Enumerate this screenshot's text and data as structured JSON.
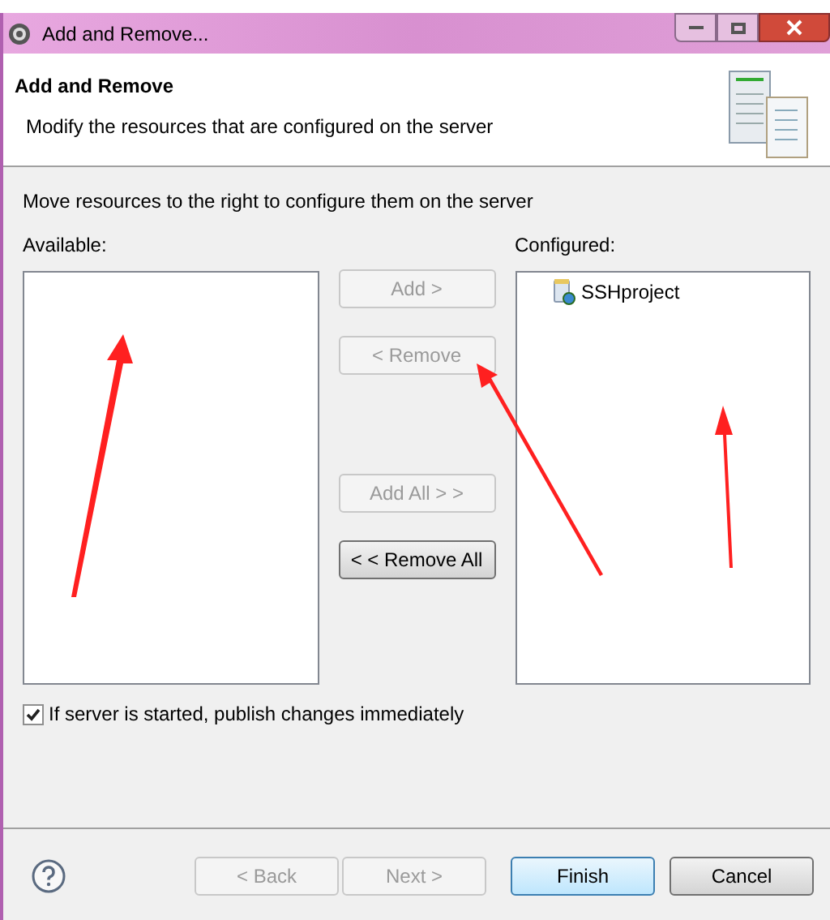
{
  "window": {
    "title": "Add and Remove..."
  },
  "header": {
    "title": "Add and Remove",
    "description": "Modify the resources that are configured on the server"
  },
  "instruction": "Move resources to the right to configure them on the server",
  "available": {
    "label": "Available:"
  },
  "configured": {
    "label": "Configured:",
    "items": [
      {
        "name": "SSHproject"
      }
    ]
  },
  "move_buttons": [
    {
      "label": "Add >",
      "disabled": true
    },
    {
      "label": "< Remove",
      "disabled": true
    },
    {
      "label": "Add All > >",
      "disabled": true
    },
    {
      "label": "< < Remove All",
      "disabled": false
    }
  ],
  "publish": {
    "label": "If server is started, publish changes immediately",
    "checked": true
  },
  "footer_buttons": [
    {
      "label": "< Back",
      "disabled": true,
      "default": false
    },
    {
      "label": "Next >",
      "disabled": true,
      "default": false
    },
    {
      "label": "Finish",
      "disabled": false,
      "default": true
    },
    {
      "label": "Cancel",
      "disabled": false,
      "default": false
    }
  ]
}
